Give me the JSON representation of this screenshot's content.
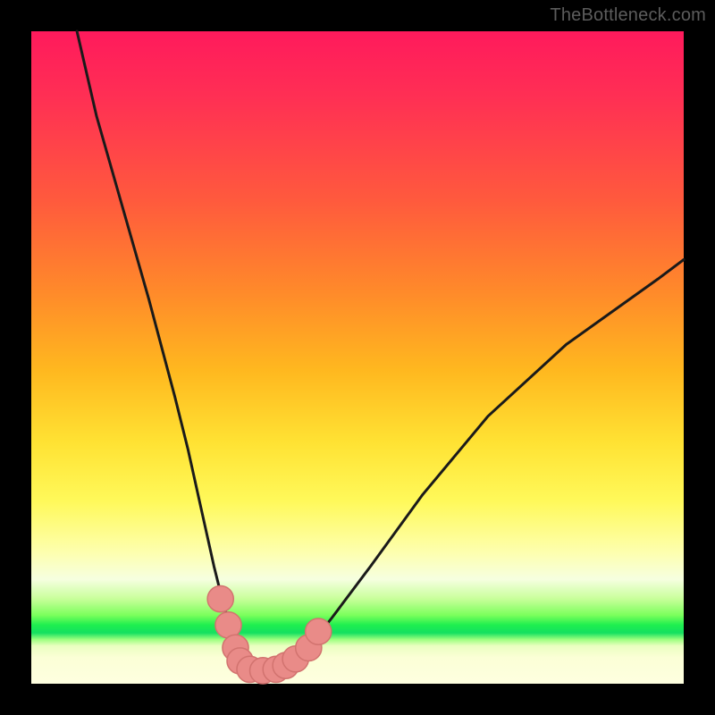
{
  "watermark": "TheBottleneck.com",
  "colors": {
    "frame": "#000000",
    "curve_stroke": "#1a1a1a",
    "marker_fill": "#e98b88",
    "marker_stroke": "#d2736f"
  },
  "chart_data": {
    "type": "line",
    "title": "",
    "xlabel": "",
    "ylabel": "",
    "xlim": [
      0,
      100
    ],
    "ylim": [
      0,
      100
    ],
    "series": [
      {
        "name": "bottleneck-curve",
        "x": [
          7,
          10,
          14,
          18,
          22,
          24,
          26,
          28,
          29.5,
          31,
          32.5,
          34,
          36,
          38,
          40,
          42,
          46,
          52,
          60,
          70,
          82,
          96,
          100
        ],
        "y": [
          100,
          87,
          73,
          59,
          44,
          36,
          27,
          18,
          12,
          7,
          4,
          2.5,
          2,
          2.2,
          3,
          5,
          10,
          18,
          29,
          41,
          52,
          62,
          65
        ]
      }
    ],
    "markers": [
      {
        "cx": 29.0,
        "cy": 13.0,
        "r": 2.0
      },
      {
        "cx": 30.2,
        "cy": 9.0,
        "r": 2.0
      },
      {
        "cx": 31.3,
        "cy": 5.5,
        "r": 2.0
      },
      {
        "cx": 32.0,
        "cy": 3.5,
        "r": 2.0
      },
      {
        "cx": 33.5,
        "cy": 2.2,
        "r": 2.0
      },
      {
        "cx": 35.5,
        "cy": 2.0,
        "r": 2.0
      },
      {
        "cx": 37.5,
        "cy": 2.2,
        "r": 2.0
      },
      {
        "cx": 39.0,
        "cy": 2.8,
        "r": 2.0
      },
      {
        "cx": 40.5,
        "cy": 3.8,
        "r": 2.0
      },
      {
        "cx": 42.5,
        "cy": 5.5,
        "r": 2.0
      },
      {
        "cx": 44.0,
        "cy": 8.0,
        "r": 2.0
      }
    ],
    "note": "x and y are percentages of the plot area; (0,0) is bottom-left of the colored square."
  }
}
